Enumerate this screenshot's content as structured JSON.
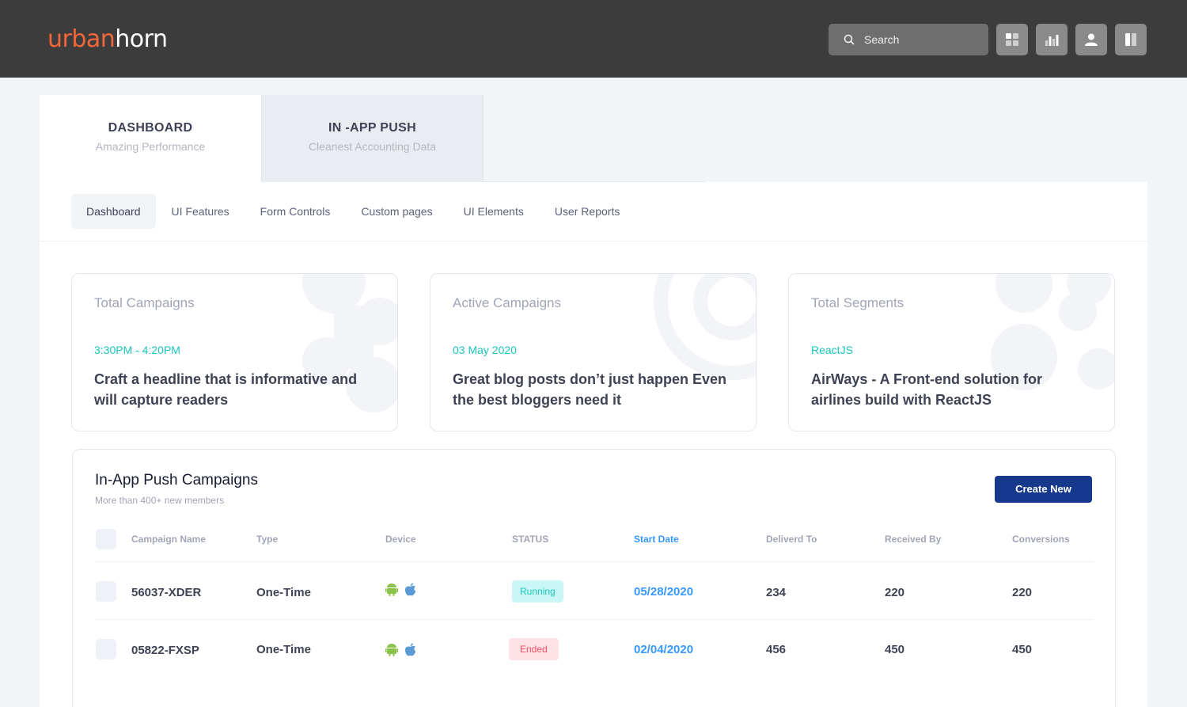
{
  "brand": {
    "part1": "urban",
    "part2": "horn",
    "accent": "#f2673a"
  },
  "search": {
    "placeholder": "Search"
  },
  "toolbar": {
    "icons": [
      "grid-icon",
      "bar-chart-icon",
      "user-icon",
      "columns-icon"
    ]
  },
  "header_tabs": [
    {
      "title": "DASHBOARD",
      "subtitle": "Amazing Performance"
    },
    {
      "title": "IN -APP PUSH",
      "subtitle": "Cleanest Accounting Data"
    }
  ],
  "subnav": [
    "Dashboard",
    "UI Features",
    "Form Controls",
    "Custom pages",
    "UI Elements",
    "User Reports"
  ],
  "cards": [
    {
      "title": "Total Campaigns",
      "meta": "3:30PM - 4:20PM",
      "body": "Craft a headline that is informative and will capture readers"
    },
    {
      "title": "Active Campaigns",
      "meta": "03 May 2020",
      "body": "Great blog posts don’t just happen Even the best bloggers need it"
    },
    {
      "title": "Total Segments",
      "meta": "ReactJS",
      "body": "AirWays - A Front-end solution for airlines build with ReactJS"
    }
  ],
  "campaigns": {
    "title": "In-App Push Campaigns",
    "subtitle": "More than 400+ new members",
    "create_label": "Create New",
    "columns": [
      "Campaign Name",
      "Type",
      "Device",
      "STATUS",
      "Start Date",
      "Deliverd To",
      "Received By",
      "Conversions"
    ],
    "rows": [
      {
        "name": "56037-XDER",
        "type": "One-Time",
        "devices": [
          "android-icon",
          "apple-icon"
        ],
        "status": "Running",
        "start": "05/28/2020",
        "delivered": "234",
        "received": "220",
        "conversions": "220"
      },
      {
        "name": "05822-FXSP",
        "type": "One-Time",
        "devices": [
          "android-icon",
          "apple-icon"
        ],
        "status": "Ended",
        "start": "02/04/2020",
        "delivered": "456",
        "received": "450",
        "conversions": "450"
      }
    ]
  },
  "colors": {
    "topbar": "#3c3c3c",
    "primary": "#17398d",
    "info": "#3699ff",
    "success": "#1bc5bd",
    "danger": "#f64e60"
  }
}
